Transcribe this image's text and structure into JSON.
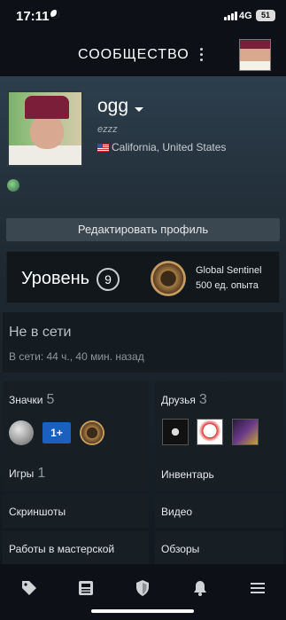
{
  "status_bar": {
    "time": "17:11",
    "network": "4G",
    "battery": "51"
  },
  "header": {
    "title": "СООБЩЕСТВО"
  },
  "profile": {
    "username": "ogg",
    "real_name": "ezzz",
    "location": "California, United States",
    "edit_button": "Редактировать профиль"
  },
  "level": {
    "label": "Уровень",
    "value": "9",
    "badge_name": "Global Sentinel",
    "badge_xp": "500 ед. опыта"
  },
  "online": {
    "status": "Не в сети",
    "last_seen": "В сети: 44 ч., 40 мин. назад"
  },
  "tiles": {
    "badges": {
      "label": "Значки",
      "count": "5",
      "badge_text": "1+"
    },
    "friends": {
      "label": "Друзья",
      "count": "3"
    },
    "games": {
      "label": "Игры",
      "count": "1"
    },
    "inventory": {
      "label": "Инвентарь"
    },
    "screenshots": {
      "label": "Скриншоты"
    },
    "videos": {
      "label": "Видео"
    },
    "workshop": {
      "label": "Работы в мастерской"
    },
    "reviews": {
      "label": "Обзоры"
    }
  },
  "nav": {
    "icons": [
      "tag-icon",
      "news-icon",
      "shield-icon",
      "bell-icon",
      "menu-icon"
    ]
  }
}
